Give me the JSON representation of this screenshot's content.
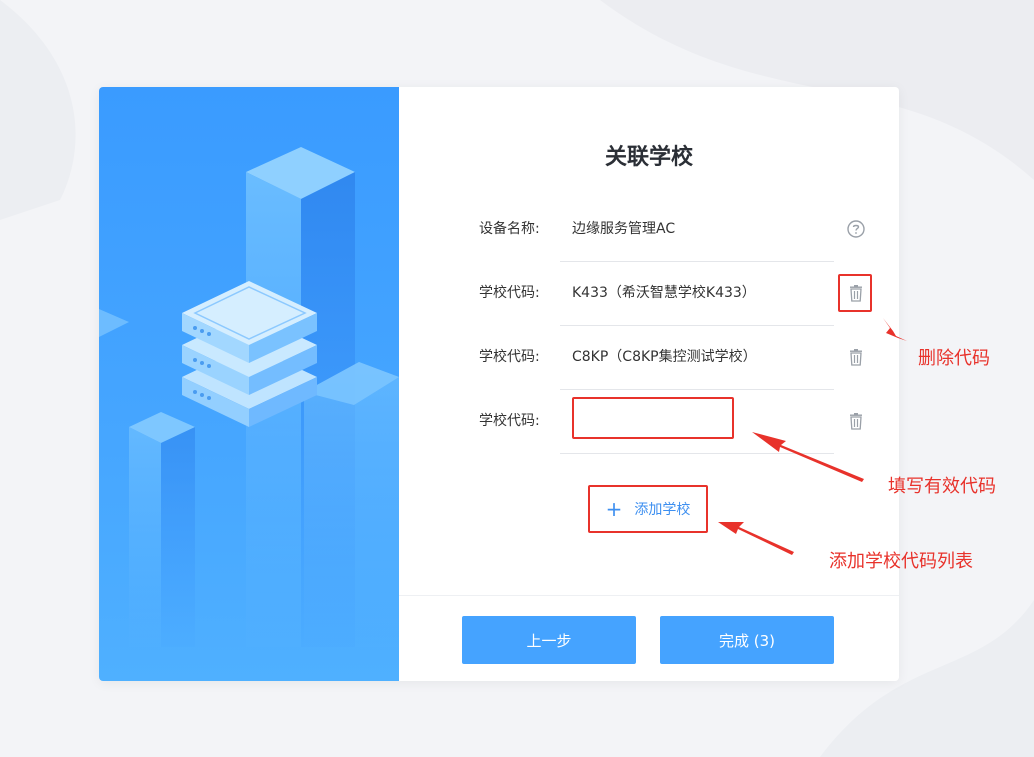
{
  "dialog": {
    "title": "关联学校",
    "rows": [
      {
        "label": "设备名称:",
        "value": "边缘服务管理AC",
        "icon": "help-icon"
      },
      {
        "label": "学校代码:",
        "value": "K433（希沃智慧学校K433）",
        "icon": "trash-icon"
      },
      {
        "label": "学校代码:",
        "value": "C8KP（C8KP集控测试学校）",
        "icon": "trash-icon"
      },
      {
        "label": "学校代码:",
        "value": "",
        "icon": "trash-icon"
      }
    ],
    "add_school": {
      "icon": "plus-icon",
      "label": "添加学校"
    },
    "buttons": {
      "prev": "上一步",
      "finish": "完成 (3)"
    }
  },
  "annotations": {
    "delete_code": "删除代码",
    "fill_valid_code": "填写有效代码",
    "add_school_list": "添加学校代码列表"
  },
  "colors": {
    "accent": "#45a3ff",
    "annotation_red": "#e8322b",
    "left_panel": "#3a9bff"
  }
}
